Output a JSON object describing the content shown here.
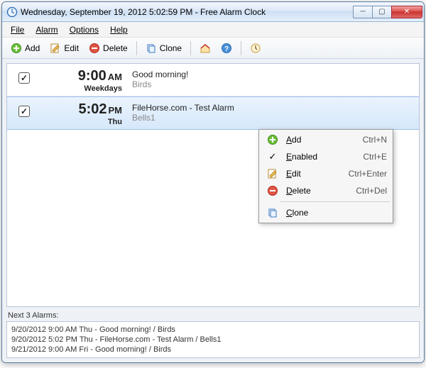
{
  "window": {
    "title": "Wednesday, September 19, 2012 5:02:59 PM - Free Alarm Clock"
  },
  "menu": {
    "file": "File",
    "alarm": "Alarm",
    "options": "Options",
    "help": "Help"
  },
  "toolbar": {
    "add": "Add",
    "edit": "Edit",
    "delete": "Delete",
    "clone": "Clone"
  },
  "alarms": [
    {
      "checked": true,
      "time": "9:00",
      "ampm": "AM",
      "days": "Weekdays",
      "title": "Good morning!",
      "sound": "Birds",
      "selected": false
    },
    {
      "checked": true,
      "time": "5:02",
      "ampm": "PM",
      "days": "Thu",
      "title": "FileHorse.com - Test Alarm",
      "sound": "Bells1",
      "selected": true
    }
  ],
  "context_menu": {
    "add": {
      "label": "Add",
      "shortcut": "Ctrl+N"
    },
    "enabled": {
      "label": "Enabled",
      "shortcut": "Ctrl+E",
      "checked": true
    },
    "edit": {
      "label": "Edit",
      "shortcut": "Ctrl+Enter"
    },
    "delete": {
      "label": "Delete",
      "shortcut": "Ctrl+Del"
    },
    "clone": {
      "label": "Clone",
      "shortcut": ""
    }
  },
  "footer": {
    "label": "Next 3 Alarms:",
    "lines": [
      "9/20/2012 9:00 AM Thu - Good morning! / Birds",
      "9/20/2012 5:02 PM Thu - FileHorse.com - Test Alarm / Bells1",
      "9/21/2012 9:00 AM Fri - Good morning! / Birds"
    ]
  }
}
